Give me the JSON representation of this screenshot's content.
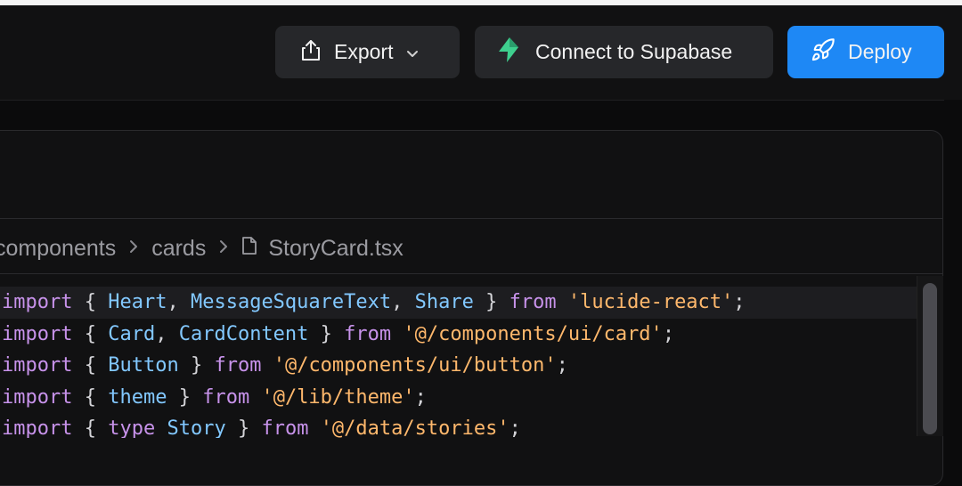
{
  "toolbar": {
    "export_label": "Export",
    "supabase_label": "Connect to Supabase",
    "deploy_label": "Deploy"
  },
  "breadcrumb": {
    "parts": [
      "components",
      "cards"
    ],
    "file": "StoryCard.tsx"
  },
  "code": {
    "lines": [
      [
        [
          "kw",
          "import"
        ],
        [
          "pn",
          " { "
        ],
        [
          "id",
          "Heart"
        ],
        [
          "pn",
          ", "
        ],
        [
          "id",
          "MessageSquareText"
        ],
        [
          "pn",
          ", "
        ],
        [
          "id",
          "Share"
        ],
        [
          "pn",
          " } "
        ],
        [
          "kw",
          "from"
        ],
        [
          "pn",
          " "
        ],
        [
          "str",
          "'lucide-react'"
        ],
        [
          "pn",
          ";"
        ]
      ],
      [
        [
          "kw",
          "import"
        ],
        [
          "pn",
          " { "
        ],
        [
          "id",
          "Card"
        ],
        [
          "pn",
          ", "
        ],
        [
          "id",
          "CardContent"
        ],
        [
          "pn",
          " } "
        ],
        [
          "kw",
          "from"
        ],
        [
          "pn",
          " "
        ],
        [
          "str",
          "'@/components/ui/card'"
        ],
        [
          "pn",
          ";"
        ]
      ],
      [
        [
          "kw",
          "import"
        ],
        [
          "pn",
          " { "
        ],
        [
          "id",
          "Button"
        ],
        [
          "pn",
          " } "
        ],
        [
          "kw",
          "from"
        ],
        [
          "pn",
          " "
        ],
        [
          "str",
          "'@/components/ui/button'"
        ],
        [
          "pn",
          ";"
        ]
      ],
      [
        [
          "kw",
          "import"
        ],
        [
          "pn",
          " { "
        ],
        [
          "id",
          "theme"
        ],
        [
          "pn",
          " } "
        ],
        [
          "kw",
          "from"
        ],
        [
          "pn",
          " "
        ],
        [
          "str",
          "'@/lib/theme'"
        ],
        [
          "pn",
          ";"
        ]
      ],
      [
        [
          "kw",
          "import"
        ],
        [
          "pn",
          " { "
        ],
        [
          "kw",
          "type"
        ],
        [
          "pn",
          " "
        ],
        [
          "id",
          "Story"
        ],
        [
          "pn",
          " } "
        ],
        [
          "kw",
          "from"
        ],
        [
          "pn",
          " "
        ],
        [
          "str",
          "'@/data/stories'"
        ],
        [
          "pn",
          ";"
        ]
      ]
    ],
    "active_line": 0
  },
  "colors": {
    "accent": "#1e88f5",
    "supabase_green": "#3ecf8e",
    "keyword": "#c792ea",
    "identifier": "#82c8ff",
    "string": "#ffb86c"
  }
}
